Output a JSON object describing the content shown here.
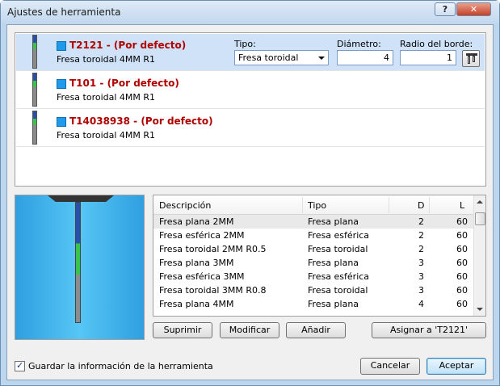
{
  "window": {
    "title": "Ajustes de herramienta",
    "help_label": "?",
    "close_label": "✕"
  },
  "tools": [
    {
      "name": "T2121 - (Por defecto)",
      "desc": "Fresa toroidal 4MM R1",
      "selected": true
    },
    {
      "name": "T101 - (Por defecto)",
      "desc": "Fresa toroidal 4MM R1",
      "selected": false
    },
    {
      "name": "T14038938 - (Por defecto)",
      "desc": "Fresa toroidal 4MM R1",
      "selected": false
    }
  ],
  "editor": {
    "type_label": "Tipo:",
    "type_value": "Fresa toroidal",
    "diameter_label": "Diámetro:",
    "diameter_value": "4",
    "radius_label": "Radio del borde:",
    "radius_value": "1"
  },
  "library": {
    "headers": {
      "desc": "Descripción",
      "type": "Tipo",
      "d": "D",
      "l": "L"
    },
    "rows": [
      {
        "desc": "Fresa plana 2MM",
        "type": "Fresa plana",
        "d": "2",
        "l": "60"
      },
      {
        "desc": "Fresa esférica 2MM",
        "type": "Fresa esférica",
        "d": "2",
        "l": "60"
      },
      {
        "desc": "Fresa toroidal 2MM R0.5",
        "type": "Fresa toroidal",
        "d": "2",
        "l": "60"
      },
      {
        "desc": "Fresa plana 3MM",
        "type": "Fresa plana",
        "d": "3",
        "l": "60"
      },
      {
        "desc": "Fresa esférica 3MM",
        "type": "Fresa esférica",
        "d": "3",
        "l": "60"
      },
      {
        "desc": "Fresa toroidal 3MM R0.8",
        "type": "Fresa toroidal",
        "d": "3",
        "l": "60"
      },
      {
        "desc": "Fresa plana 4MM",
        "type": "Fresa plana",
        "d": "4",
        "l": "60"
      }
    ]
  },
  "buttons": {
    "delete": "Suprimir",
    "modify": "Modificar",
    "add": "Añadir",
    "assign": "Asignar a 'T2121'",
    "cancel": "Cancelar",
    "accept": "Aceptar"
  },
  "save_info": {
    "label": "Guardar la información de la herramienta",
    "checked": true
  },
  "colors": {
    "tool_name": "#b00000",
    "selected_row": "#cfe2f7",
    "swatch": "#1e9bea"
  }
}
